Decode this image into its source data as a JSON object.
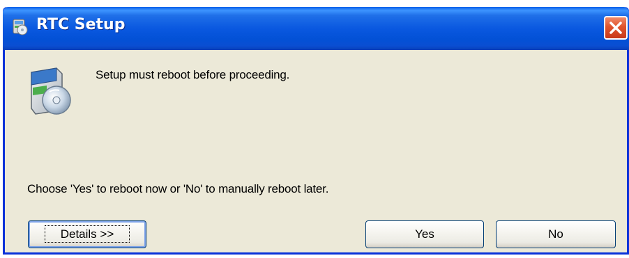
{
  "window": {
    "title": "RTC Setup",
    "title_icon": "setup-installer-icon",
    "close_icon": "close-icon",
    "accent_color": "#0a58e0",
    "close_color": "#e0542c",
    "face_color": "#ece9d8"
  },
  "content": {
    "icon": "setup-cd-box-icon",
    "message": "Setup must reboot before proceeding.",
    "instruction": "Choose 'Yes' to reboot now or 'No' to manually reboot later."
  },
  "buttons": {
    "details_label": "Details >>",
    "yes_label": "Yes",
    "no_label": "No"
  }
}
